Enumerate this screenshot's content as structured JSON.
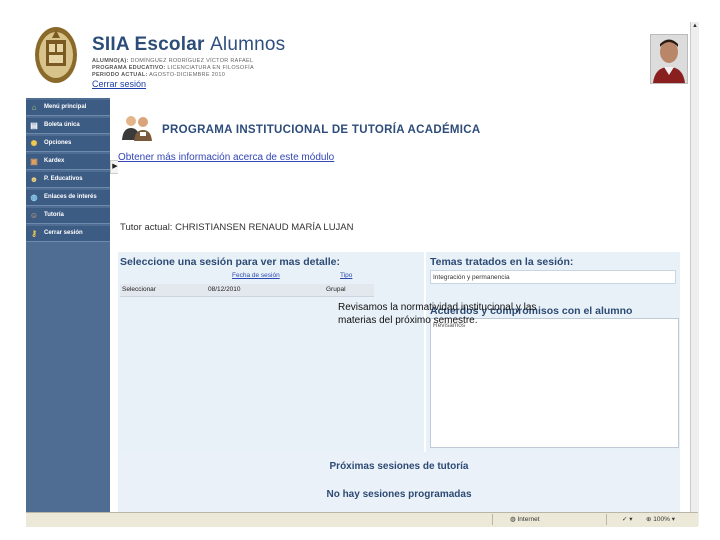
{
  "header": {
    "brand_main": "SIIA Escolar",
    "brand_sub": "Alumnos",
    "student_label": "ALUMNO(A):",
    "student_name": "DOMÍNGUEZ RODRÍGUEZ VÍCTOR RAFAEL",
    "program_label": "PROGRAMA EDUCATIVO:",
    "program_name": "LICENCIATURA EN FILOSOFÍA",
    "period_label": "PERIODO ACTUAL:",
    "period_name": "AGOSTO-DICIEMBRE 2010",
    "logout_link": "Cerrar sesión"
  },
  "sidebar": {
    "items": [
      {
        "label": "Menú principal",
        "icon": "home-icon"
      },
      {
        "label": "Boleta única",
        "icon": "document-icon"
      },
      {
        "label": "Opciones",
        "icon": "gear-icon"
      },
      {
        "label": "Kardex",
        "icon": "book-icon"
      },
      {
        "label": "P. Educativos",
        "icon": "users-icon"
      },
      {
        "label": "Enlaces de interés",
        "icon": "globe-icon"
      },
      {
        "label": "Tutoría",
        "icon": "tutor-icon"
      },
      {
        "label": "Cerrar sesión",
        "icon": "key-icon"
      }
    ]
  },
  "main": {
    "title": "PROGRAMA INSTITUCIONAL DE TUTORÍA ACADÉMICA",
    "more_info_link": "Obtener más información acerca de este módulo",
    "tutor_line": "Tutor actual: CHRISTIANSEN RENAUD MARÍA LUJAN",
    "sessions": {
      "title": "Seleccione una sesión para ver mas detalle:",
      "col_date": "Fecha de sesión",
      "col_type": "Tipo",
      "rows": [
        {
          "select": "Seleccionar",
          "date": "08/12/2010",
          "type": "Grupal"
        }
      ]
    },
    "topics": {
      "title": "Temas tratados en la sesión:",
      "value": "Integración y permanencia"
    },
    "agreements": {
      "title": "Acuerdos y compromisos con el alumno",
      "ghost": "Revisamos",
      "text": "Revisamos la normatividad institucional y las materias del próximo semestre."
    },
    "next_sessions": {
      "title": "Próximas sesiones de tutoría",
      "none": "No hay sesiones programadas"
    }
  },
  "statusbar": {
    "zone": "Internet",
    "zoom": "100%"
  },
  "colors": {
    "sidebar_bg": "#4f6d92",
    "title_blue": "#2e4c7a",
    "link_blue": "#3346b5",
    "panel_bg": "#e8f1f8"
  }
}
